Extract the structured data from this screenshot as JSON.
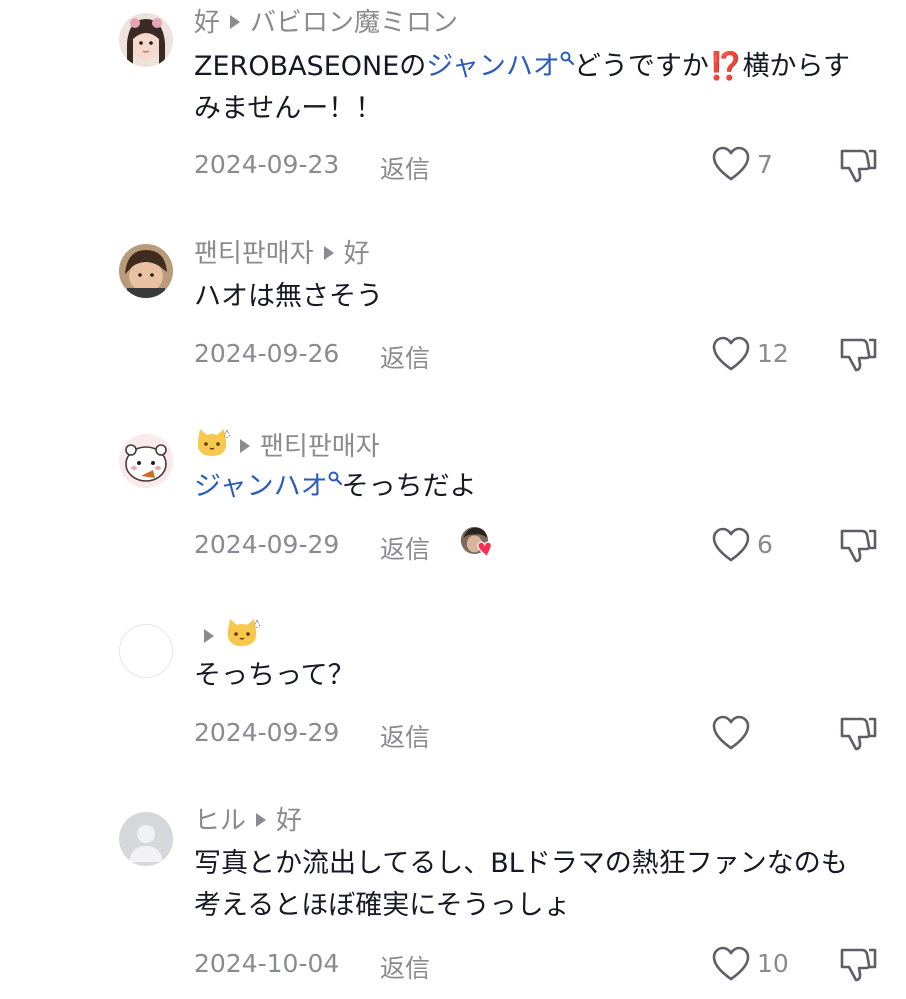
{
  "comments": [
    {
      "username": "好",
      "reply_to": "バビロン魔ミロン",
      "text_parts": [
        "ZEROBASEONEの",
        "ジャンハオ",
        "どうですか",
        "⁉️",
        "横からすみませんー！！"
      ],
      "date": "2024-09-23",
      "reply_label": "返信",
      "likes": "7"
    },
    {
      "username": "팬티판매자",
      "reply_to": "好",
      "text": "ハオは無さそう",
      "date": "2024-09-26",
      "reply_label": "返信",
      "likes": "12"
    },
    {
      "username": "🐱",
      "reply_to": "팬티판매자",
      "text_parts": [
        "ジャンハオ",
        "そっちだよ"
      ],
      "date": "2024-09-29",
      "reply_label": "返信",
      "likes": "6"
    },
    {
      "username": "",
      "reply_to": "🐱",
      "text": "そっちって？",
      "date": "2024-09-29",
      "reply_label": "返信",
      "likes": ""
    },
    {
      "username": "ヒル",
      "reply_to": "好",
      "text_lines": [
        "写真とか流出してるし、BLドラマの熱狂ファンなのも",
        "考えるとほぼ確実にそうっしょ"
      ],
      "date": "2024-10-04",
      "reply_label": "返信",
      "likes": "10"
    }
  ],
  "colors": {
    "meta": "#8a8b91",
    "text": "#161823",
    "tag": "#2b5db9",
    "heart_badge": "#fe2c55"
  },
  "icons": [
    "heart-icon",
    "dislike-icon",
    "search-tag-icon",
    "play-arrow-icon"
  ]
}
